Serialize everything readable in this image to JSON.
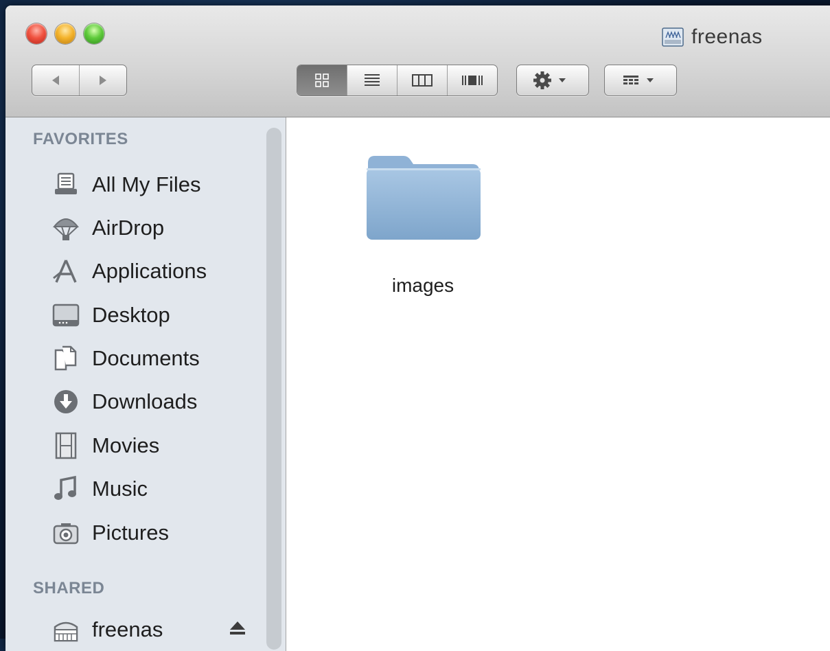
{
  "window": {
    "title": "freenas",
    "title_icon": "network-drive-icon"
  },
  "toolbar": {
    "nav": [
      {
        "icon": "back-icon"
      },
      {
        "icon": "forward-icon"
      }
    ],
    "view_modes": [
      {
        "icon": "icon-view-icon",
        "active": true
      },
      {
        "icon": "list-view-icon",
        "active": false
      },
      {
        "icon": "column-view-icon",
        "active": false
      },
      {
        "icon": "coverflow-view-icon",
        "active": false
      }
    ],
    "action": {
      "icon": "gear-icon"
    },
    "arrange": {
      "icon": "arrange-icon"
    }
  },
  "sidebar": {
    "favorites_header": "FAVORITES",
    "favorites": [
      {
        "label": "All My Files",
        "icon": "all-files-icon"
      },
      {
        "label": "AirDrop",
        "icon": "airdrop-icon"
      },
      {
        "label": "Applications",
        "icon": "applications-icon"
      },
      {
        "label": "Desktop",
        "icon": "desktop-icon"
      },
      {
        "label": "Documents",
        "icon": "documents-icon"
      },
      {
        "label": "Downloads",
        "icon": "downloads-icon"
      },
      {
        "label": "Movies",
        "icon": "movies-icon"
      },
      {
        "label": "Music",
        "icon": "music-icon"
      },
      {
        "label": "Pictures",
        "icon": "pictures-icon"
      }
    ],
    "shared_header": "SHARED",
    "shared": [
      {
        "label": "freenas",
        "icon": "server-icon",
        "eject": true
      }
    ]
  },
  "content": {
    "items": [
      {
        "label": "images",
        "type": "folder"
      }
    ]
  }
}
